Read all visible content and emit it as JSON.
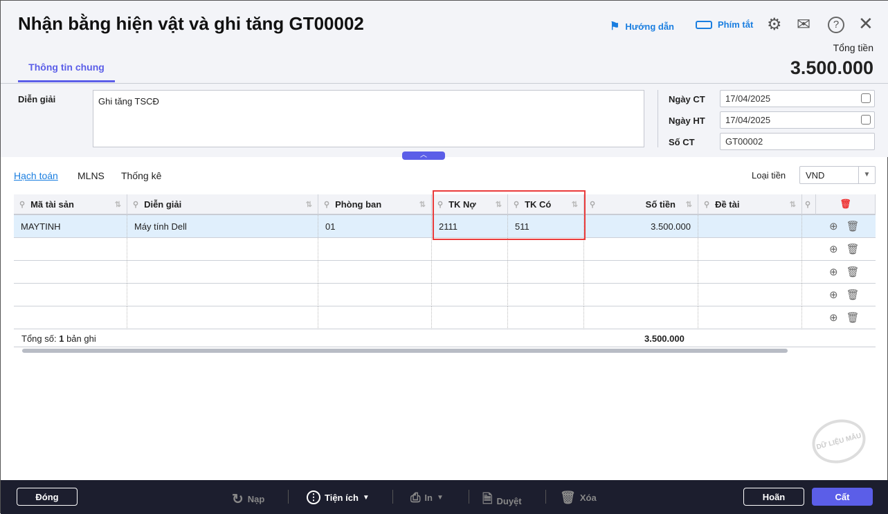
{
  "header": {
    "title": "Nhận bằng hiện vật và ghi tăng GT00002",
    "guide": "Hướng dẫn",
    "shortcuts": "Phím tắt",
    "total_label": "Tổng tiền",
    "total_value": "3.500.000"
  },
  "tabs": [
    {
      "label": "Thông tin chung"
    }
  ],
  "form": {
    "desc_label": "Diễn giải",
    "desc_value": "Ghi tăng TSCĐ",
    "ngay_ct_label": "Ngày CT",
    "ngay_ct": "17/04/2025",
    "ngay_ht_label": "Ngày HT",
    "ngay_ht": "17/04/2025",
    "so_ct_label": "Số CT",
    "so_ct": "GT00002"
  },
  "subtabs": [
    "Hạch toán",
    "MLNS",
    "Thống kê"
  ],
  "currency": {
    "label": "Loại tiền",
    "value": "VND"
  },
  "grid": {
    "columns": [
      "Mã tài sản",
      "Diễn giải",
      "Phòng ban",
      "TK Nợ",
      "TK Có",
      "Số tiền",
      "Đề tài"
    ],
    "rows": [
      [
        "MAYTINH",
        "Máy tính Dell",
        "01",
        "2111",
        "511",
        "3.500.000",
        ""
      ]
    ],
    "footer_prefix": "Tổng số:",
    "footer_count": "1",
    "footer_suffix": "bản ghi",
    "footer_total": "3.500.000"
  },
  "watermark": "DỮ LIỆU MẪU",
  "toolbar": {
    "close": "Đóng",
    "reload": "Nạp",
    "utilities": "Tiện ích",
    "print": "In",
    "approve": "Duyệt",
    "delete": "Xóa",
    "cancel": "Hoãn",
    "save": "Cất"
  },
  "colors": {
    "accent": "#5b5ee8",
    "link": "#1a7ee0",
    "highlight": "#ea3b3b",
    "footer": "#1c1e2e"
  }
}
